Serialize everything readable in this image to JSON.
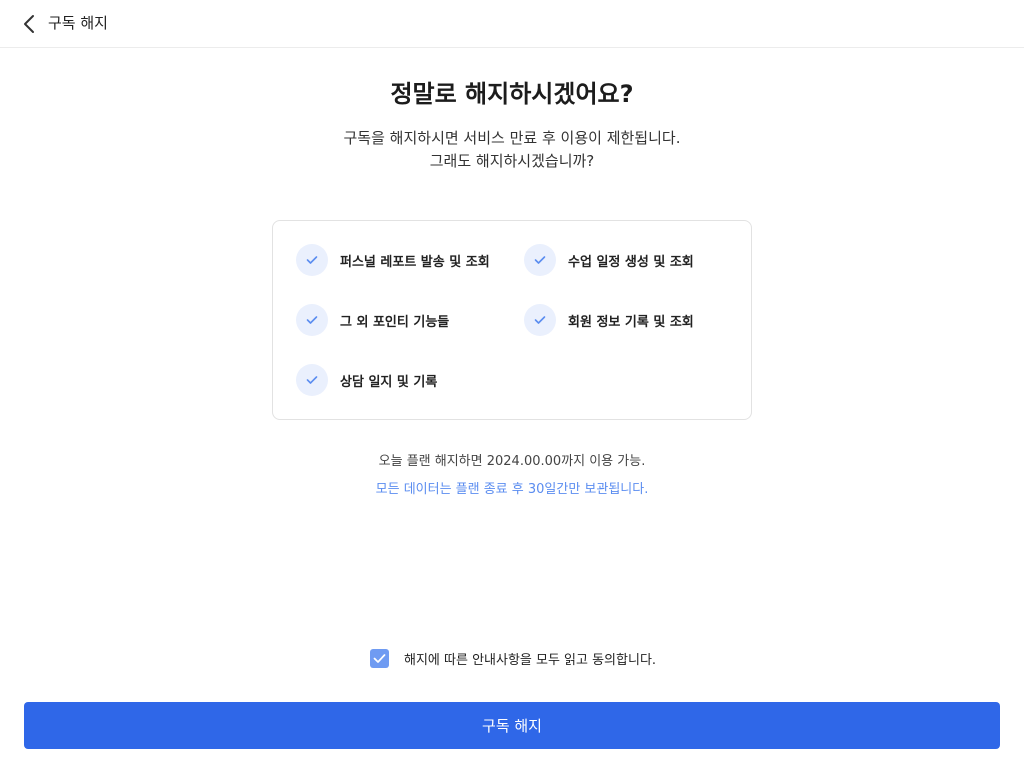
{
  "header": {
    "title": "구독 해지",
    "back_icon": "chevron-left-icon"
  },
  "main": {
    "title": "정말로 해지하시겠어요?",
    "description_line1": "구독을 해지하시면 서비스 만료 후 이용이 제한됩니다.",
    "description_line2": "그래도 해지하시겠습니까?",
    "features": [
      {
        "label": "퍼스널 레포트 발송 및 조회"
      },
      {
        "label": "수업 일정 생성 및 조회"
      },
      {
        "label": "그 외 포인티 기능들"
      },
      {
        "label": "회원 정보 기록 및 조회"
      },
      {
        "label": "상담 일지 및 기록"
      }
    ],
    "note_availability": "오늘 플랜 해지하면 2024.00.00까지 이용 가능.",
    "note_retention": "모든 데이터는 플랜 종료 후 30일간만 보관됩니다."
  },
  "agreement": {
    "checked": true,
    "label": "해지에 따른 안내사항을 모두 읽고 동의합니다."
  },
  "cta": {
    "label": "구독 해지"
  },
  "colors": {
    "primary": "#2f67e8",
    "checkbox": "#6f9bf2",
    "check_circle_bg": "#eaf0fd",
    "check_mark": "#5b8df0",
    "note_link": "#5b8df0"
  }
}
